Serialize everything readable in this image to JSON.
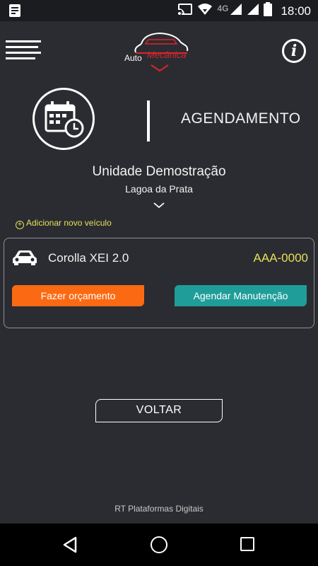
{
  "status_bar": {
    "time": "18:00",
    "network": "4G",
    "icons": [
      "notification-icon",
      "cast-icon",
      "wifi-icon",
      "signal-icon",
      "battery-icon"
    ]
  },
  "header": {
    "logo_text_1": "Auto",
    "logo_text_2": "Mecânica",
    "menu_icon": "menu-icon",
    "info_label": "i"
  },
  "section": {
    "title": "AGENDAMENTO",
    "icon": "calendar-clock-icon"
  },
  "unit": {
    "name": "Unidade Demostração",
    "city": "Lagoa da Prata"
  },
  "add_vehicle": {
    "label": "Adicionar novo veículo"
  },
  "vehicle": {
    "name": "Corolla XEI 2.0",
    "plate": "AAA-0000",
    "quote_button": "Fazer orçamento",
    "schedule_button": "Agendar Manutenção"
  },
  "back_button": "VOLTAR",
  "footer": "RT Plataformas Digitais",
  "colors": {
    "background": "#2b2c31",
    "accent_yellow": "#e5e05a",
    "orange": "#fb6a13",
    "teal": "#1f9d99",
    "logo_red": "#d9252a"
  }
}
